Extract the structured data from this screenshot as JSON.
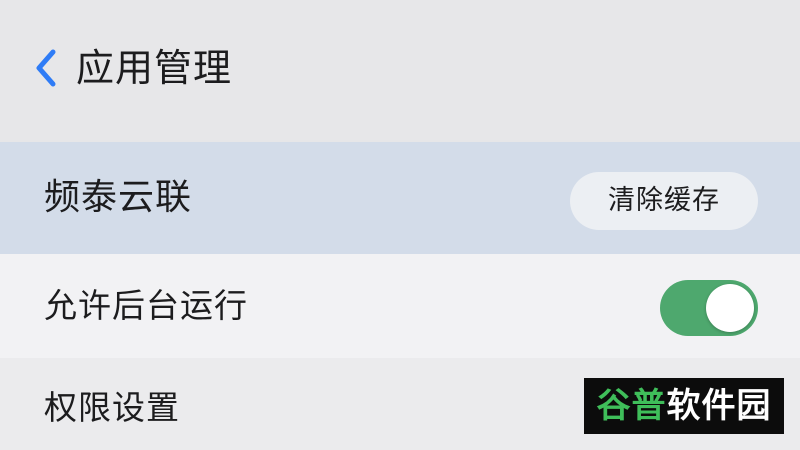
{
  "header": {
    "title": "应用管理",
    "back_icon": "chevron-left-icon",
    "back_color": "#2f7cf6"
  },
  "app_row": {
    "name": "频泰云联",
    "clear_cache_label": "清除缓存"
  },
  "background_row": {
    "label": "允许后台运行",
    "toggle_on": true,
    "toggle_color": "#4ea86e"
  },
  "permission_row": {
    "label": "权限设置"
  },
  "watermark": {
    "part1": "谷普",
    "part2": "软件园"
  }
}
